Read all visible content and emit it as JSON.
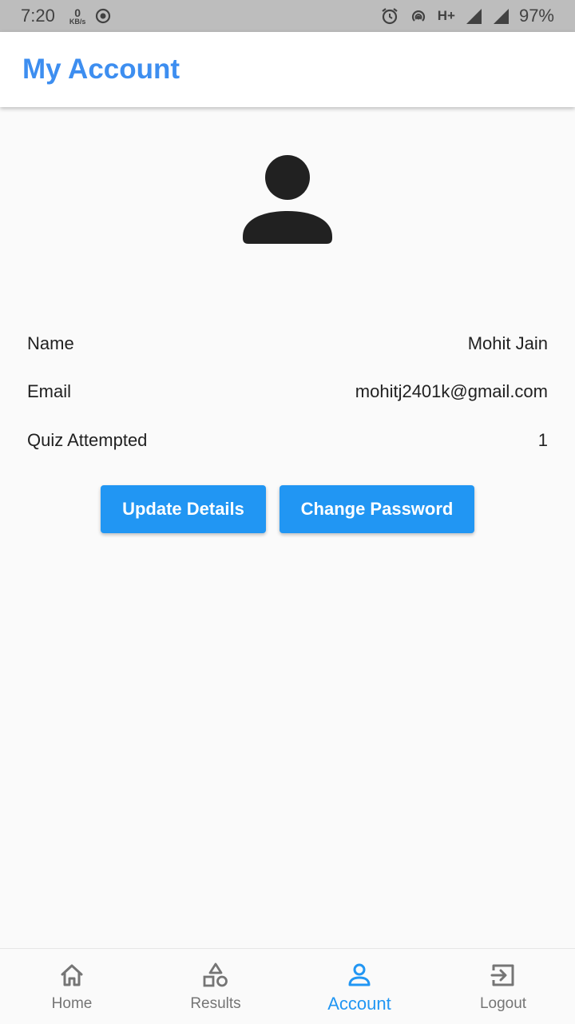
{
  "status_bar": {
    "time": "7:20",
    "speed_value": "0",
    "speed_unit": "KB/s",
    "network": "H+",
    "battery": "97%"
  },
  "header": {
    "title": "My Account"
  },
  "profile": {
    "rows": [
      {
        "label": "Name",
        "value": "Mohit Jain"
      },
      {
        "label": "Email",
        "value": "mohitj2401k@gmail.com"
      },
      {
        "label": "Quiz Attempted",
        "value": "1"
      }
    ]
  },
  "actions": {
    "update_label": "Update Details",
    "change_password_label": "Change Password"
  },
  "bottom_nav": {
    "items": [
      {
        "label": "Home",
        "icon": "home-icon"
      },
      {
        "label": "Results",
        "icon": "shapes-icon"
      },
      {
        "label": "Account",
        "icon": "person-icon"
      },
      {
        "label": "Logout",
        "icon": "logout-icon"
      }
    ],
    "active_index": 2
  },
  "colors": {
    "accent": "#2196f3",
    "title": "#3d8ef0",
    "status_bar": "#bdbdbd"
  }
}
